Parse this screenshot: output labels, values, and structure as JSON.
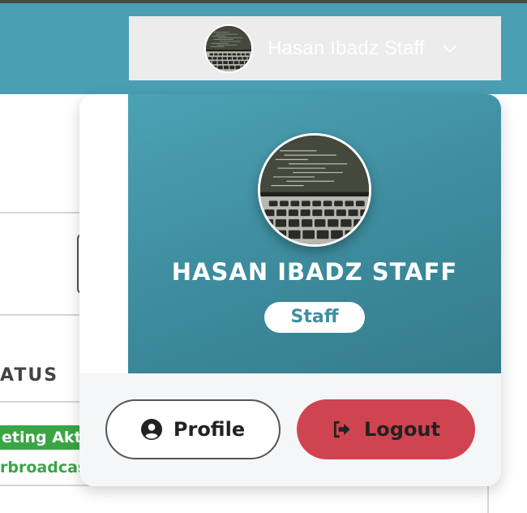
{
  "header": {
    "user_name": "Hasan Ibadz Staff"
  },
  "background": {
    "column_header": "ATUS",
    "badge_text": "eting Akti",
    "green_text": "rbroadcas",
    "colors": {
      "active_badge": "#3aa544"
    }
  },
  "dropdown": {
    "name": "HASAN IBADZ STAFF",
    "role": "Staff",
    "profile_label": "Profile",
    "logout_label": "Logout"
  },
  "colors": {
    "header_bg": "#4a9fb3",
    "card_gradient_start": "#4ba2b4",
    "card_gradient_end": "#347c8c",
    "logout_bg": "#cf4450"
  },
  "icons": [
    "chevron-down-icon",
    "user-circle-icon",
    "logout-icon"
  ]
}
